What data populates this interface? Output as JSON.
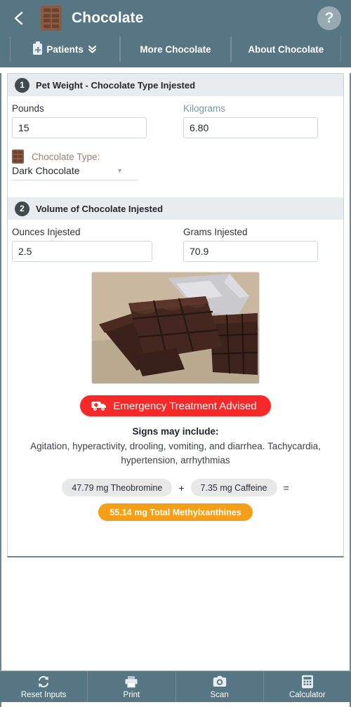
{
  "header": {
    "back_icon": "back-chevron-icon",
    "app_icon": "chocolate-bar-icon",
    "title": "Chocolate",
    "help_label": "?"
  },
  "tabs": [
    {
      "label": "Patients",
      "icon": "clipboard-medical-icon",
      "caret": "chevron-double-down-icon"
    },
    {
      "label": "More Chocolate"
    },
    {
      "label": "About Chocolate"
    }
  ],
  "sections": [
    {
      "number": "1",
      "title": "Pet Weight - Chocolate Type Injested",
      "fields": [
        {
          "label": "Pounds",
          "value": "15"
        },
        {
          "label": "Kilograms",
          "value": "6.80"
        }
      ],
      "chocolate_type": {
        "label": "Chocolate Type:",
        "value": "Dark Chocolate",
        "icon": "chocolate-bar-icon",
        "caret": "chevron-down-icon"
      }
    },
    {
      "number": "2",
      "title": "Volume of Chocolate Injested",
      "fields": [
        {
          "label": "Ounces Injested",
          "value": "2.5"
        },
        {
          "label": "Grams Injested",
          "value": "70.9"
        }
      ]
    }
  ],
  "photo": {
    "alt": "dark-chocolate-bars-photo"
  },
  "alert": {
    "label": "Emergency Treatment Advised",
    "icon": "ambulance-icon",
    "color": "#f62828"
  },
  "signs": {
    "title": "Signs may include:",
    "text": "Agitation, hyperactivity, drooling, vomiting, and diarrhea. Tachycardia, hypertension, arrhythmias"
  },
  "results": {
    "theobromine": "47.79 mg Theobromine",
    "plus": "+",
    "caffeine": "7.35 mg Caffeine",
    "equals": "=",
    "total": "55.14 mg Total Methylxanthines",
    "total_color": "#f59e17"
  },
  "footer": [
    {
      "label": "Reset Inputs",
      "icon": "refresh-icon"
    },
    {
      "label": "Print",
      "icon": "printer-icon"
    },
    {
      "label": "Scan",
      "icon": "camera-icon"
    },
    {
      "label": "Calculator",
      "icon": "calculator-icon"
    }
  ],
  "theme": {
    "header_bg": "#577684",
    "section_bg": "#e9ecee",
    "badge_bg": "#3f4a52"
  }
}
